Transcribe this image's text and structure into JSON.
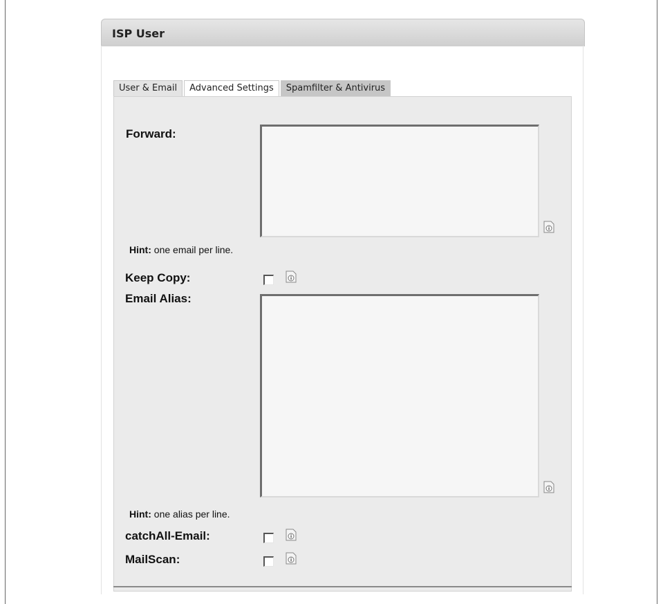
{
  "panel": {
    "title": "ISP User"
  },
  "tabs": [
    {
      "label": "User & Email",
      "active": false
    },
    {
      "label": "Advanced Settings",
      "active": true
    },
    {
      "label": "Spamfilter & Antivirus",
      "active": false
    }
  ],
  "form": {
    "forward": {
      "label": "Forward:",
      "value": "",
      "hint_bold": "Hint:",
      "hint_text": " one email per line."
    },
    "keep_copy": {
      "label": "Keep Copy:",
      "checked": false
    },
    "email_alias": {
      "label": "Email Alias:",
      "value": "",
      "hint_bold": "Hint:",
      "hint_text": " one alias per line."
    },
    "catchall_email": {
      "label": "catchAll-Email:",
      "checked": false
    },
    "mailscan": {
      "label": "MailScan:",
      "checked": false
    }
  },
  "icons": {
    "info": "info-icon"
  }
}
